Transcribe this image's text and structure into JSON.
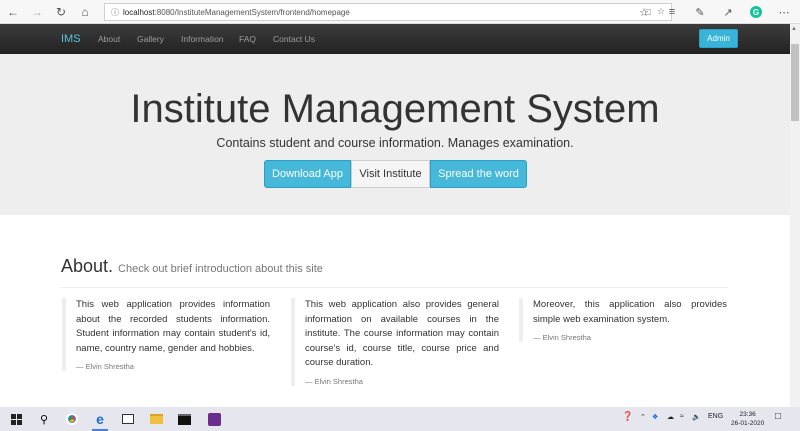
{
  "browser": {
    "url_host": "localhost",
    "url_path": ":8080/InstituteManagementSystem/frontend/homepage"
  },
  "navbar": {
    "brand": "IMS",
    "links": [
      "About",
      "Gallery",
      "Information",
      "FAQ",
      "Contact Us"
    ],
    "admin_label": "Admin"
  },
  "jumbotron": {
    "title": "Institute Management System",
    "subtitle": "Contains student and course information. Manages examination.",
    "buttons": [
      "Download App",
      "Visit Institute",
      "Spread the word"
    ]
  },
  "about": {
    "heading": "About.",
    "subheading": "Check out brief introduction about this site",
    "quotes": [
      {
        "text": "This web application provides information about the recorded students information. Student information may contain student's id, name, country name, gender and hobbies.",
        "author": "— Elvin Shrestha"
      },
      {
        "text": "This web application also provides general information on available courses in the institute. The course information may contain course's id, course title, course price and course duration.",
        "author": "— Elvin Shrestha"
      },
      {
        "text": "Moreover, this application also provides simple web examination system.",
        "author": "— Elvin Shrestha"
      }
    ]
  },
  "taskbar": {
    "language": "ENG",
    "time": "23:36",
    "date": "26-01-2020"
  },
  "colors": {
    "accent": "#46b8da",
    "brand": "#5bc0de",
    "navbar": "#222222",
    "jumbotron": "#eeeeee"
  }
}
